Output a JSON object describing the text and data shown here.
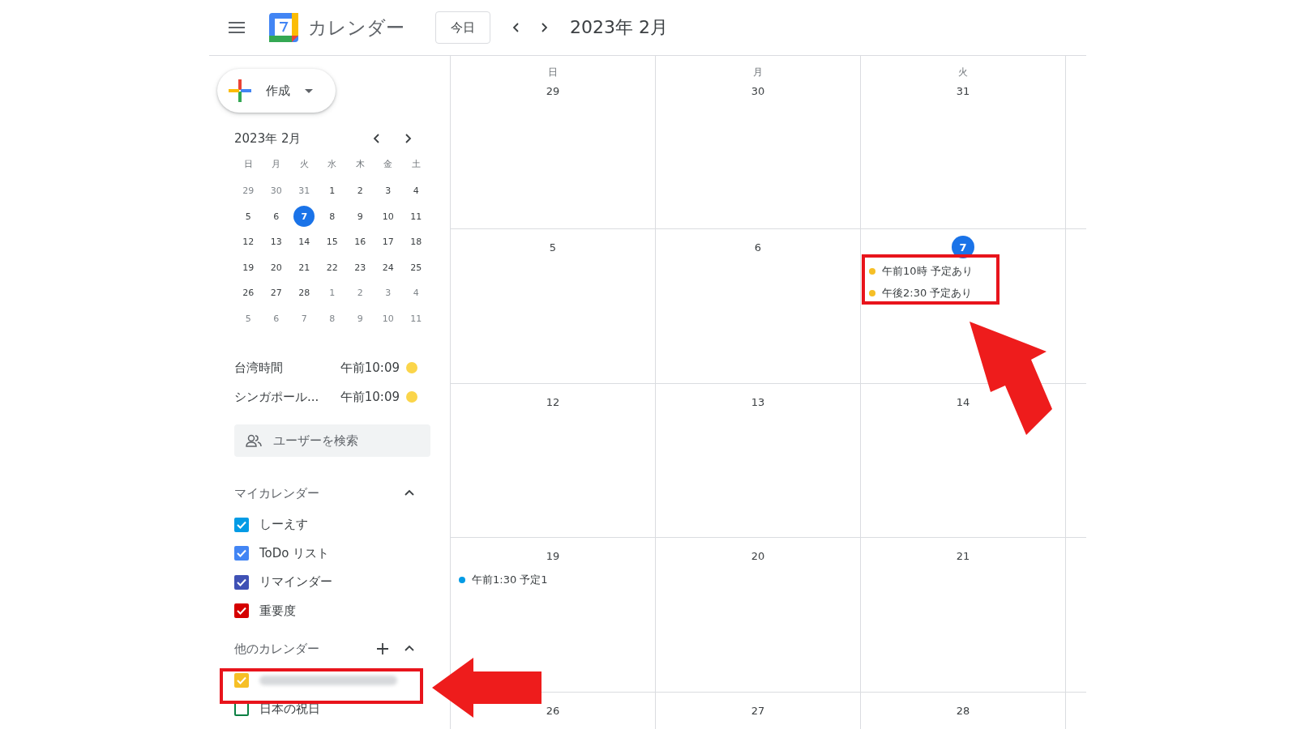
{
  "header": {
    "app_title": "カレンダー",
    "today_button": "今日",
    "period": "2023年 2月"
  },
  "sidebar": {
    "create_button": "作成",
    "mini_calendar": {
      "title": "2023年 2月",
      "weekdays": [
        "日",
        "月",
        "火",
        "水",
        "木",
        "金",
        "土"
      ],
      "weeks": [
        [
          {
            "day": "29",
            "muted": true,
            "selected": false
          },
          {
            "day": "30",
            "muted": true,
            "selected": false
          },
          {
            "day": "31",
            "muted": true,
            "selected": false
          },
          {
            "day": "1",
            "muted": false,
            "selected": false
          },
          {
            "day": "2",
            "muted": false,
            "selected": false
          },
          {
            "day": "3",
            "muted": false,
            "selected": false
          },
          {
            "day": "4",
            "muted": false,
            "selected": false
          }
        ],
        [
          {
            "day": "5",
            "muted": false,
            "selected": false
          },
          {
            "day": "6",
            "muted": false,
            "selected": false
          },
          {
            "day": "7",
            "muted": false,
            "selected": true
          },
          {
            "day": "8",
            "muted": false,
            "selected": false
          },
          {
            "day": "9",
            "muted": false,
            "selected": false
          },
          {
            "day": "10",
            "muted": false,
            "selected": false
          },
          {
            "day": "11",
            "muted": false,
            "selected": false
          }
        ],
        [
          {
            "day": "12",
            "muted": false,
            "selected": false
          },
          {
            "day": "13",
            "muted": false,
            "selected": false
          },
          {
            "day": "14",
            "muted": false,
            "selected": false
          },
          {
            "day": "15",
            "muted": false,
            "selected": false
          },
          {
            "day": "16",
            "muted": false,
            "selected": false
          },
          {
            "day": "17",
            "muted": false,
            "selected": false
          },
          {
            "day": "18",
            "muted": false,
            "selected": false
          }
        ],
        [
          {
            "day": "19",
            "muted": false,
            "selected": false
          },
          {
            "day": "20",
            "muted": false,
            "selected": false
          },
          {
            "day": "21",
            "muted": false,
            "selected": false
          },
          {
            "day": "22",
            "muted": false,
            "selected": false
          },
          {
            "day": "23",
            "muted": false,
            "selected": false
          },
          {
            "day": "24",
            "muted": false,
            "selected": false
          },
          {
            "day": "25",
            "muted": false,
            "selected": false
          }
        ],
        [
          {
            "day": "26",
            "muted": false,
            "selected": false
          },
          {
            "day": "27",
            "muted": false,
            "selected": false
          },
          {
            "day": "28",
            "muted": false,
            "selected": false
          },
          {
            "day": "1",
            "muted": true,
            "selected": false
          },
          {
            "day": "2",
            "muted": true,
            "selected": false
          },
          {
            "day": "3",
            "muted": true,
            "selected": false
          },
          {
            "day": "4",
            "muted": true,
            "selected": false
          }
        ],
        [
          {
            "day": "5",
            "muted": true,
            "selected": false
          },
          {
            "day": "6",
            "muted": true,
            "selected": false
          },
          {
            "day": "7",
            "muted": true,
            "selected": false
          },
          {
            "day": "8",
            "muted": true,
            "selected": false
          },
          {
            "day": "9",
            "muted": true,
            "selected": false
          },
          {
            "day": "10",
            "muted": true,
            "selected": false
          },
          {
            "day": "11",
            "muted": true,
            "selected": false
          }
        ]
      ]
    },
    "world_clocks": [
      {
        "name": "台湾時間",
        "time": "午前10:09"
      },
      {
        "name": "シンガポール...",
        "time": "午前10:09"
      }
    ],
    "people_search": {
      "placeholder": "ユーザーを検索"
    },
    "my_calendars": {
      "title": "マイカレンダー",
      "expanded": true,
      "items": [
        {
          "kind": "text",
          "label": "しーえす",
          "checked": true,
          "color": "#039be5"
        },
        {
          "kind": "text",
          "label": "ToDo リスト",
          "checked": true,
          "color": "#4285f4"
        },
        {
          "kind": "text",
          "label": "リマインダー",
          "checked": true,
          "color": "#3f51b5"
        },
        {
          "kind": "text",
          "label": "重要度",
          "checked": true,
          "color": "#d50000"
        }
      ]
    },
    "other_calendars": {
      "title": "他のカレンダー",
      "expanded": true,
      "items": [
        {
          "kind": "redacted",
          "checked": true,
          "color": "#f6bf26"
        },
        {
          "kind": "text",
          "label": "日本の祝日",
          "checked": false,
          "color": "#0b8043"
        }
      ]
    }
  },
  "grid": {
    "weekdays": [
      "日",
      "月",
      "火"
    ],
    "weeks": [
      [
        {
          "day": "29",
          "today": false
        },
        {
          "day": "30",
          "today": false
        },
        {
          "day": "31",
          "today": false
        }
      ],
      [
        {
          "day": "5",
          "today": false
        },
        {
          "day": "6",
          "today": false
        },
        {
          "day": "7",
          "today": true,
          "events": [
            {
              "text": "午前10時 予定あり",
              "color": "#f6bf26"
            },
            {
              "text": "午後2:30 予定あり",
              "color": "#f6bf26"
            }
          ]
        }
      ],
      [
        {
          "day": "12",
          "today": false
        },
        {
          "day": "13",
          "today": false
        },
        {
          "day": "14",
          "today": false
        }
      ],
      [
        {
          "day": "19",
          "today": false,
          "events": [
            {
              "text": "午前1:30 予定1",
              "color": "#039be5"
            }
          ]
        },
        {
          "day": "20",
          "today": false
        },
        {
          "day": "21",
          "today": false
        }
      ],
      [
        {
          "day": "26",
          "today": false
        },
        {
          "day": "27",
          "today": false
        },
        {
          "day": "28",
          "today": false
        }
      ]
    ]
  }
}
